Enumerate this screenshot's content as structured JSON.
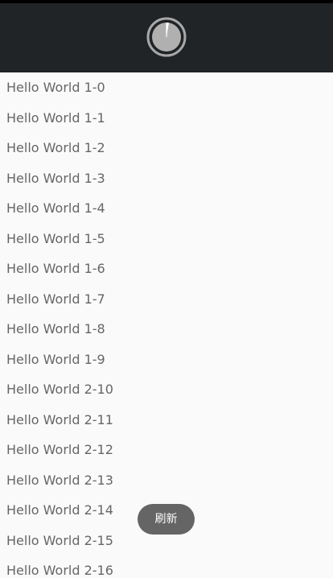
{
  "header": {
    "refresh_icon": "circular-refresh-progress-icon",
    "background_color": "#202426"
  },
  "list": {
    "items": [
      "Hello World 1-0",
      "Hello World 1-1",
      "Hello World 1-2",
      "Hello World 1-3",
      "Hello World 1-4",
      "Hello World 1-5",
      "Hello World 1-6",
      "Hello World 1-7",
      "Hello World 1-8",
      "Hello World 1-9",
      "Hello World 2-10",
      "Hello World 2-11",
      "Hello World 2-12",
      "Hello World 2-13",
      "Hello World 2-14",
      "Hello World 2-15",
      "Hello World 2-16"
    ]
  },
  "toast": {
    "text": "刷新"
  }
}
